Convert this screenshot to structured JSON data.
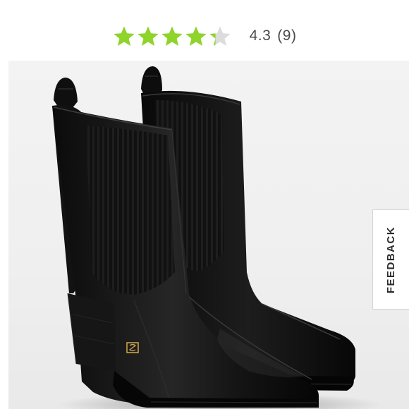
{
  "rating": {
    "score": "4.3",
    "count": "(9)",
    "value": 4.3,
    "max": 5,
    "star_color": "#8fd42a",
    "empty_star_color": "#dcdcdc"
  },
  "product_image": {
    "subject": "black square-toe chelsea boots with ribbed elastic panels and pull tabs",
    "logo_color": "#c8a24a"
  },
  "feedback": {
    "label": "FEEDBACK"
  }
}
